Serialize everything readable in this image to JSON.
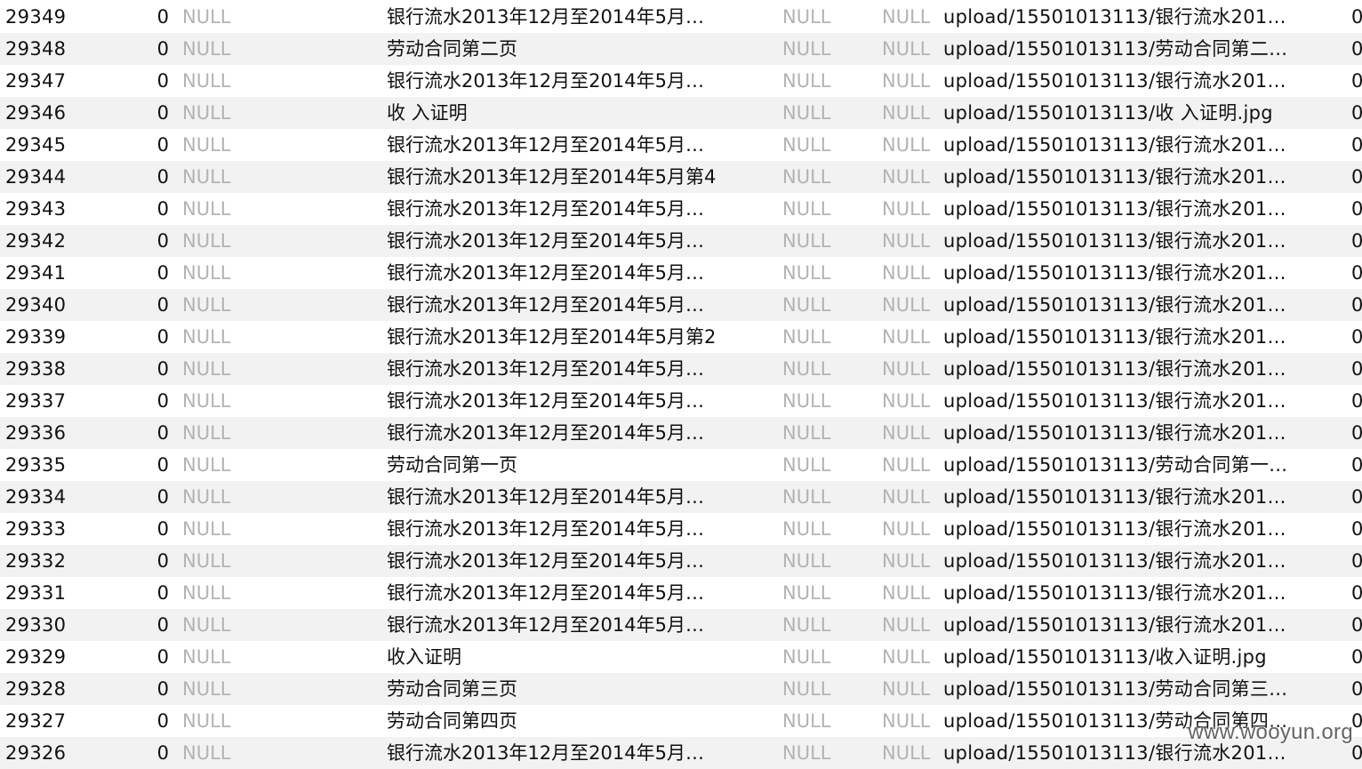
{
  "table": {
    "rows": [
      {
        "id": "29349",
        "num": "0",
        "col3": "NULL",
        "name": "银行流水2013年12月至2014年5月…",
        "col5": "NULL",
        "col6": "NULL",
        "path": "upload/15501013113/银行流水201…",
        "last": "0"
      },
      {
        "id": "29348",
        "num": "0",
        "col3": "NULL",
        "name": "劳动合同第二页",
        "col5": "NULL",
        "col6": "NULL",
        "path": "upload/15501013113/劳动合同第二…",
        "last": "0"
      },
      {
        "id": "29347",
        "num": "0",
        "col3": "NULL",
        "name": "银行流水2013年12月至2014年5月…",
        "col5": "NULL",
        "col6": "NULL",
        "path": "upload/15501013113/银行流水201…",
        "last": "0"
      },
      {
        "id": "29346",
        "num": "0",
        "col3": "NULL",
        "name": "收 入证明",
        "col5": "NULL",
        "col6": "NULL",
        "path": "upload/15501013113/收 入证明.jpg",
        "last": "0"
      },
      {
        "id": "29345",
        "num": "0",
        "col3": "NULL",
        "name": "银行流水2013年12月至2014年5月…",
        "col5": "NULL",
        "col6": "NULL",
        "path": "upload/15501013113/银行流水201…",
        "last": "0"
      },
      {
        "id": "29344",
        "num": "0",
        "col3": "NULL",
        "name": "银行流水2013年12月至2014年5月第4",
        "col5": "NULL",
        "col6": "NULL",
        "path": "upload/15501013113/银行流水201…",
        "last": "0"
      },
      {
        "id": "29343",
        "num": "0",
        "col3": "NULL",
        "name": "银行流水2013年12月至2014年5月…",
        "col5": "NULL",
        "col6": "NULL",
        "path": "upload/15501013113/银行流水201…",
        "last": "0"
      },
      {
        "id": "29342",
        "num": "0",
        "col3": "NULL",
        "name": "银行流水2013年12月至2014年5月…",
        "col5": "NULL",
        "col6": "NULL",
        "path": "upload/15501013113/银行流水201…",
        "last": "0"
      },
      {
        "id": "29341",
        "num": "0",
        "col3": "NULL",
        "name": "银行流水2013年12月至2014年5月…",
        "col5": "NULL",
        "col6": "NULL",
        "path": "upload/15501013113/银行流水201…",
        "last": "0"
      },
      {
        "id": "29340",
        "num": "0",
        "col3": "NULL",
        "name": "银行流水2013年12月至2014年5月…",
        "col5": "NULL",
        "col6": "NULL",
        "path": "upload/15501013113/银行流水201…",
        "last": "0"
      },
      {
        "id": "29339",
        "num": "0",
        "col3": "NULL",
        "name": "银行流水2013年12月至2014年5月第2",
        "col5": "NULL",
        "col6": "NULL",
        "path": "upload/15501013113/银行流水201…",
        "last": "0"
      },
      {
        "id": "29338",
        "num": "0",
        "col3": "NULL",
        "name": "银行流水2013年12月至2014年5月…",
        "col5": "NULL",
        "col6": "NULL",
        "path": "upload/15501013113/银行流水201…",
        "last": "0"
      },
      {
        "id": "29337",
        "num": "0",
        "col3": "NULL",
        "name": "银行流水2013年12月至2014年5月…",
        "col5": "NULL",
        "col6": "NULL",
        "path": "upload/15501013113/银行流水201…",
        "last": "0"
      },
      {
        "id": "29336",
        "num": "0",
        "col3": "NULL",
        "name": "银行流水2013年12月至2014年5月…",
        "col5": "NULL",
        "col6": "NULL",
        "path": "upload/15501013113/银行流水201…",
        "last": "0"
      },
      {
        "id": "29335",
        "num": "0",
        "col3": "NULL",
        "name": "劳动合同第一页",
        "col5": "NULL",
        "col6": "NULL",
        "path": "upload/15501013113/劳动合同第一…",
        "last": "0"
      },
      {
        "id": "29334",
        "num": "0",
        "col3": "NULL",
        "name": "银行流水2013年12月至2014年5月…",
        "col5": "NULL",
        "col6": "NULL",
        "path": "upload/15501013113/银行流水201…",
        "last": "0"
      },
      {
        "id": "29333",
        "num": "0",
        "col3": "NULL",
        "name": "银行流水2013年12月至2014年5月…",
        "col5": "NULL",
        "col6": "NULL",
        "path": "upload/15501013113/银行流水201…",
        "last": "0"
      },
      {
        "id": "29332",
        "num": "0",
        "col3": "NULL",
        "name": "银行流水2013年12月至2014年5月…",
        "col5": "NULL",
        "col6": "NULL",
        "path": "upload/15501013113/银行流水201…",
        "last": "0"
      },
      {
        "id": "29331",
        "num": "0",
        "col3": "NULL",
        "name": "银行流水2013年12月至2014年5月…",
        "col5": "NULL",
        "col6": "NULL",
        "path": "upload/15501013113/银行流水201…",
        "last": "0"
      },
      {
        "id": "29330",
        "num": "0",
        "col3": "NULL",
        "name": "银行流水2013年12月至2014年5月…",
        "col5": "NULL",
        "col6": "NULL",
        "path": "upload/15501013113/银行流水201…",
        "last": "0"
      },
      {
        "id": "29329",
        "num": "0",
        "col3": "NULL",
        "name": "收入证明",
        "col5": "NULL",
        "col6": "NULL",
        "path": "upload/15501013113/收入证明.jpg",
        "last": "0"
      },
      {
        "id": "29328",
        "num": "0",
        "col3": "NULL",
        "name": "劳动合同第三页",
        "col5": "NULL",
        "col6": "NULL",
        "path": "upload/15501013113/劳动合同第三…",
        "last": "0"
      },
      {
        "id": "29327",
        "num": "0",
        "col3": "NULL",
        "name": "劳动合同第四页",
        "col5": "NULL",
        "col6": "NULL",
        "path": "upload/15501013113/劳动合同第四…",
        "last": "0"
      },
      {
        "id": "29326",
        "num": "0",
        "col3": "NULL",
        "name": "银行流水2013年12月至2014年5月…",
        "col5": "NULL",
        "col6": "NULL",
        "path": "upload/15501013113/银行流水201…",
        "last": "0"
      }
    ]
  },
  "watermark": "www.wooyun.org",
  "colors": {
    "null_text": "#b3b3b3",
    "text": "#111111",
    "row_alt": "#f2f2f2",
    "row_base": "#ffffff"
  }
}
